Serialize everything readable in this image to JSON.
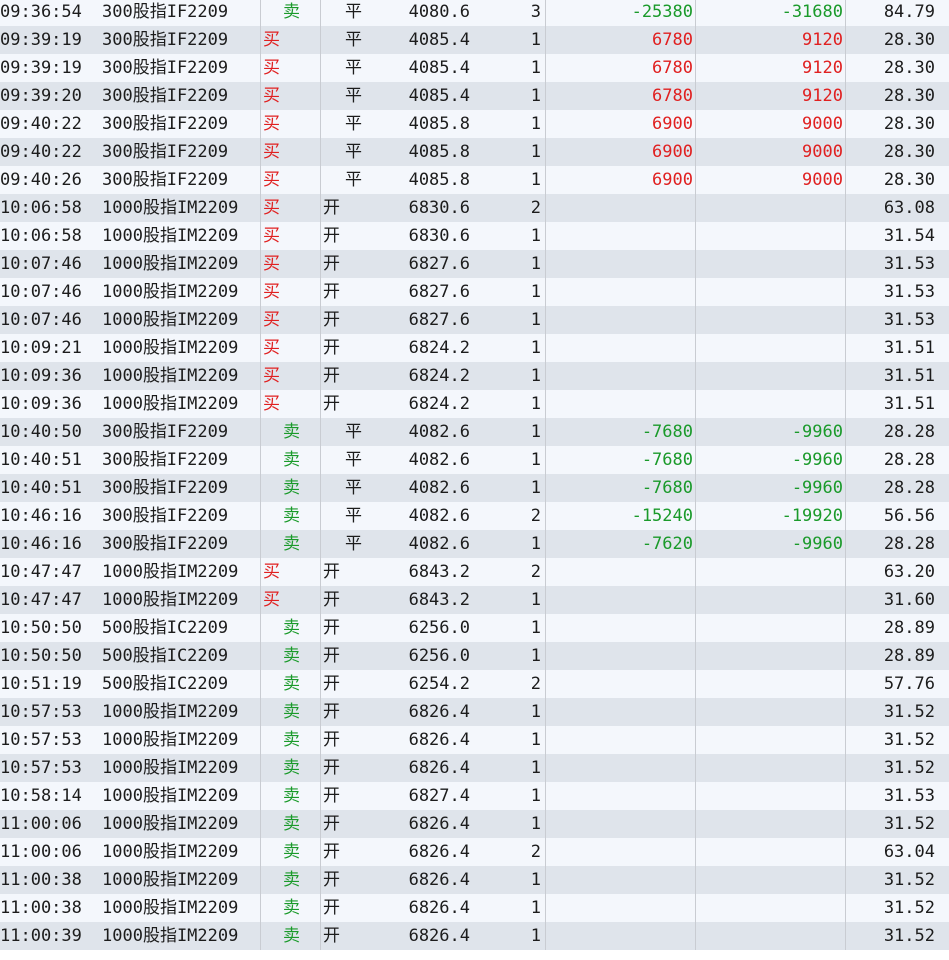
{
  "colors": {
    "buy": "#e02020",
    "sell": "#1a9a2a",
    "row_light": "#f4f7fc",
    "row_dark": "#dfe4eb"
  },
  "rows": [
    {
      "time": "09:36:54",
      "name": "300股指IF2209",
      "side": "卖",
      "side_type": "sell",
      "oc": "平",
      "oc_type": "ping",
      "price": "4080.6",
      "qty": "3",
      "pl1": "-25380",
      "pl2": "-31680",
      "fee": "84.79"
    },
    {
      "time": "09:39:19",
      "name": "300股指IF2209",
      "side": "买",
      "side_type": "buy",
      "oc": "平",
      "oc_type": "ping",
      "price": "4085.4",
      "qty": "1",
      "pl1": "6780",
      "pl2": "9120",
      "fee": "28.30"
    },
    {
      "time": "09:39:19",
      "name": "300股指IF2209",
      "side": "买",
      "side_type": "buy",
      "oc": "平",
      "oc_type": "ping",
      "price": "4085.4",
      "qty": "1",
      "pl1": "6780",
      "pl2": "9120",
      "fee": "28.30"
    },
    {
      "time": "09:39:20",
      "name": "300股指IF2209",
      "side": "买",
      "side_type": "buy",
      "oc": "平",
      "oc_type": "ping",
      "price": "4085.4",
      "qty": "1",
      "pl1": "6780",
      "pl2": "9120",
      "fee": "28.30"
    },
    {
      "time": "09:40:22",
      "name": "300股指IF2209",
      "side": "买",
      "side_type": "buy",
      "oc": "平",
      "oc_type": "ping",
      "price": "4085.8",
      "qty": "1",
      "pl1": "6900",
      "pl2": "9000",
      "fee": "28.30"
    },
    {
      "time": "09:40:22",
      "name": "300股指IF2209",
      "side": "买",
      "side_type": "buy",
      "oc": "平",
      "oc_type": "ping",
      "price": "4085.8",
      "qty": "1",
      "pl1": "6900",
      "pl2": "9000",
      "fee": "28.30"
    },
    {
      "time": "09:40:26",
      "name": "300股指IF2209",
      "side": "买",
      "side_type": "buy",
      "oc": "平",
      "oc_type": "ping",
      "price": "4085.8",
      "qty": "1",
      "pl1": "6900",
      "pl2": "9000",
      "fee": "28.30"
    },
    {
      "time": "10:06:58",
      "name": "1000股指IM2209",
      "side": "买",
      "side_type": "buy",
      "oc": "开",
      "oc_type": "kai",
      "price": "6830.6",
      "qty": "2",
      "pl1": "",
      "pl2": "",
      "fee": "63.08"
    },
    {
      "time": "10:06:58",
      "name": "1000股指IM2209",
      "side": "买",
      "side_type": "buy",
      "oc": "开",
      "oc_type": "kai",
      "price": "6830.6",
      "qty": "1",
      "pl1": "",
      "pl2": "",
      "fee": "31.54"
    },
    {
      "time": "10:07:46",
      "name": "1000股指IM2209",
      "side": "买",
      "side_type": "buy",
      "oc": "开",
      "oc_type": "kai",
      "price": "6827.6",
      "qty": "1",
      "pl1": "",
      "pl2": "",
      "fee": "31.53"
    },
    {
      "time": "10:07:46",
      "name": "1000股指IM2209",
      "side": "买",
      "side_type": "buy",
      "oc": "开",
      "oc_type": "kai",
      "price": "6827.6",
      "qty": "1",
      "pl1": "",
      "pl2": "",
      "fee": "31.53"
    },
    {
      "time": "10:07:46",
      "name": "1000股指IM2209",
      "side": "买",
      "side_type": "buy",
      "oc": "开",
      "oc_type": "kai",
      "price": "6827.6",
      "qty": "1",
      "pl1": "",
      "pl2": "",
      "fee": "31.53"
    },
    {
      "time": "10:09:21",
      "name": "1000股指IM2209",
      "side": "买",
      "side_type": "buy",
      "oc": "开",
      "oc_type": "kai",
      "price": "6824.2",
      "qty": "1",
      "pl1": "",
      "pl2": "",
      "fee": "31.51"
    },
    {
      "time": "10:09:36",
      "name": "1000股指IM2209",
      "side": "买",
      "side_type": "buy",
      "oc": "开",
      "oc_type": "kai",
      "price": "6824.2",
      "qty": "1",
      "pl1": "",
      "pl2": "",
      "fee": "31.51"
    },
    {
      "time": "10:09:36",
      "name": "1000股指IM2209",
      "side": "买",
      "side_type": "buy",
      "oc": "开",
      "oc_type": "kai",
      "price": "6824.2",
      "qty": "1",
      "pl1": "",
      "pl2": "",
      "fee": "31.51"
    },
    {
      "time": "10:40:50",
      "name": "300股指IF2209",
      "side": "卖",
      "side_type": "sell",
      "oc": "平",
      "oc_type": "ping",
      "price": "4082.6",
      "qty": "1",
      "pl1": "-7680",
      "pl2": "-9960",
      "fee": "28.28"
    },
    {
      "time": "10:40:51",
      "name": "300股指IF2209",
      "side": "卖",
      "side_type": "sell",
      "oc": "平",
      "oc_type": "ping",
      "price": "4082.6",
      "qty": "1",
      "pl1": "-7680",
      "pl2": "-9960",
      "fee": "28.28"
    },
    {
      "time": "10:40:51",
      "name": "300股指IF2209",
      "side": "卖",
      "side_type": "sell",
      "oc": "平",
      "oc_type": "ping",
      "price": "4082.6",
      "qty": "1",
      "pl1": "-7680",
      "pl2": "-9960",
      "fee": "28.28"
    },
    {
      "time": "10:46:16",
      "name": "300股指IF2209",
      "side": "卖",
      "side_type": "sell",
      "oc": "平",
      "oc_type": "ping",
      "price": "4082.6",
      "qty": "2",
      "pl1": "-15240",
      "pl2": "-19920",
      "fee": "56.56"
    },
    {
      "time": "10:46:16",
      "name": "300股指IF2209",
      "side": "卖",
      "side_type": "sell",
      "oc": "平",
      "oc_type": "ping",
      "price": "4082.6",
      "qty": "1",
      "pl1": "-7620",
      "pl2": "-9960",
      "fee": "28.28"
    },
    {
      "time": "10:47:47",
      "name": "1000股指IM2209",
      "side": "买",
      "side_type": "buy",
      "oc": "开",
      "oc_type": "kai",
      "price": "6843.2",
      "qty": "2",
      "pl1": "",
      "pl2": "",
      "fee": "63.20"
    },
    {
      "time": "10:47:47",
      "name": "1000股指IM2209",
      "side": "买",
      "side_type": "buy",
      "oc": "开",
      "oc_type": "kai",
      "price": "6843.2",
      "qty": "1",
      "pl1": "",
      "pl2": "",
      "fee": "31.60"
    },
    {
      "time": "10:50:50",
      "name": "500股指IC2209",
      "side": "卖",
      "side_type": "sell",
      "oc": "开",
      "oc_type": "kai",
      "price": "6256.0",
      "qty": "1",
      "pl1": "",
      "pl2": "",
      "fee": "28.89"
    },
    {
      "time": "10:50:50",
      "name": "500股指IC2209",
      "side": "卖",
      "side_type": "sell",
      "oc": "开",
      "oc_type": "kai",
      "price": "6256.0",
      "qty": "1",
      "pl1": "",
      "pl2": "",
      "fee": "28.89"
    },
    {
      "time": "10:51:19",
      "name": "500股指IC2209",
      "side": "卖",
      "side_type": "sell",
      "oc": "开",
      "oc_type": "kai",
      "price": "6254.2",
      "qty": "2",
      "pl1": "",
      "pl2": "",
      "fee": "57.76"
    },
    {
      "time": "10:57:53",
      "name": "1000股指IM2209",
      "side": "卖",
      "side_type": "sell",
      "oc": "开",
      "oc_type": "kai",
      "price": "6826.4",
      "qty": "1",
      "pl1": "",
      "pl2": "",
      "fee": "31.52"
    },
    {
      "time": "10:57:53",
      "name": "1000股指IM2209",
      "side": "卖",
      "side_type": "sell",
      "oc": "开",
      "oc_type": "kai",
      "price": "6826.4",
      "qty": "1",
      "pl1": "",
      "pl2": "",
      "fee": "31.52"
    },
    {
      "time": "10:57:53",
      "name": "1000股指IM2209",
      "side": "卖",
      "side_type": "sell",
      "oc": "开",
      "oc_type": "kai",
      "price": "6826.4",
      "qty": "1",
      "pl1": "",
      "pl2": "",
      "fee": "31.52"
    },
    {
      "time": "10:58:14",
      "name": "1000股指IM2209",
      "side": "卖",
      "side_type": "sell",
      "oc": "开",
      "oc_type": "kai",
      "price": "6827.4",
      "qty": "1",
      "pl1": "",
      "pl2": "",
      "fee": "31.53"
    },
    {
      "time": "11:00:06",
      "name": "1000股指IM2209",
      "side": "卖",
      "side_type": "sell",
      "oc": "开",
      "oc_type": "kai",
      "price": "6826.4",
      "qty": "1",
      "pl1": "",
      "pl2": "",
      "fee": "31.52"
    },
    {
      "time": "11:00:06",
      "name": "1000股指IM2209",
      "side": "卖",
      "side_type": "sell",
      "oc": "开",
      "oc_type": "kai",
      "price": "6826.4",
      "qty": "2",
      "pl1": "",
      "pl2": "",
      "fee": "63.04"
    },
    {
      "time": "11:00:38",
      "name": "1000股指IM2209",
      "side": "卖",
      "side_type": "sell",
      "oc": "开",
      "oc_type": "kai",
      "price": "6826.4",
      "qty": "1",
      "pl1": "",
      "pl2": "",
      "fee": "31.52"
    },
    {
      "time": "11:00:38",
      "name": "1000股指IM2209",
      "side": "卖",
      "side_type": "sell",
      "oc": "开",
      "oc_type": "kai",
      "price": "6826.4",
      "qty": "1",
      "pl1": "",
      "pl2": "",
      "fee": "31.52"
    },
    {
      "time": "11:00:39",
      "name": "1000股指IM2209",
      "side": "卖",
      "side_type": "sell",
      "oc": "开",
      "oc_type": "kai",
      "price": "6826.4",
      "qty": "1",
      "pl1": "",
      "pl2": "",
      "fee": "31.52"
    }
  ]
}
